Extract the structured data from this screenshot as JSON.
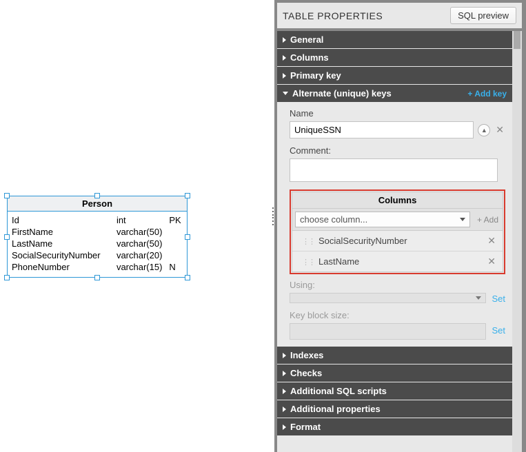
{
  "entity": {
    "name": "Person",
    "columns": [
      {
        "name": "Id",
        "type": "int",
        "flag": "PK"
      },
      {
        "name": "FirstName",
        "type": "varchar(50)",
        "flag": ""
      },
      {
        "name": "LastName",
        "type": "varchar(50)",
        "flag": ""
      },
      {
        "name": "SocialSecurityNumber",
        "type": "varchar(20)",
        "flag": ""
      },
      {
        "name": "PhoneNumber",
        "type": "varchar(15)",
        "flag": "N"
      }
    ]
  },
  "panel": {
    "title": "TABLE PROPERTIES",
    "sql_preview": "SQL preview",
    "sections": {
      "general": "General",
      "columns": "Columns",
      "primary_key": "Primary key",
      "alternate_keys": "Alternate (unique) keys",
      "indexes": "Indexes",
      "checks": "Checks",
      "add_sql": "Additional SQL scripts",
      "add_props": "Additional properties",
      "format": "Format"
    },
    "add_key": "+ Add key"
  },
  "alt_key": {
    "name_label": "Name",
    "name_value": "UniqueSSN",
    "comment_label": "Comment:",
    "comment_value": "",
    "columns_title": "Columns",
    "choose_placeholder": "choose column...",
    "add_label": "+ Add",
    "selected_columns": [
      "SocialSecurityNumber",
      "LastName"
    ],
    "using_label": "Using:",
    "block_size_label": "Key block size:",
    "set_label": "Set"
  }
}
